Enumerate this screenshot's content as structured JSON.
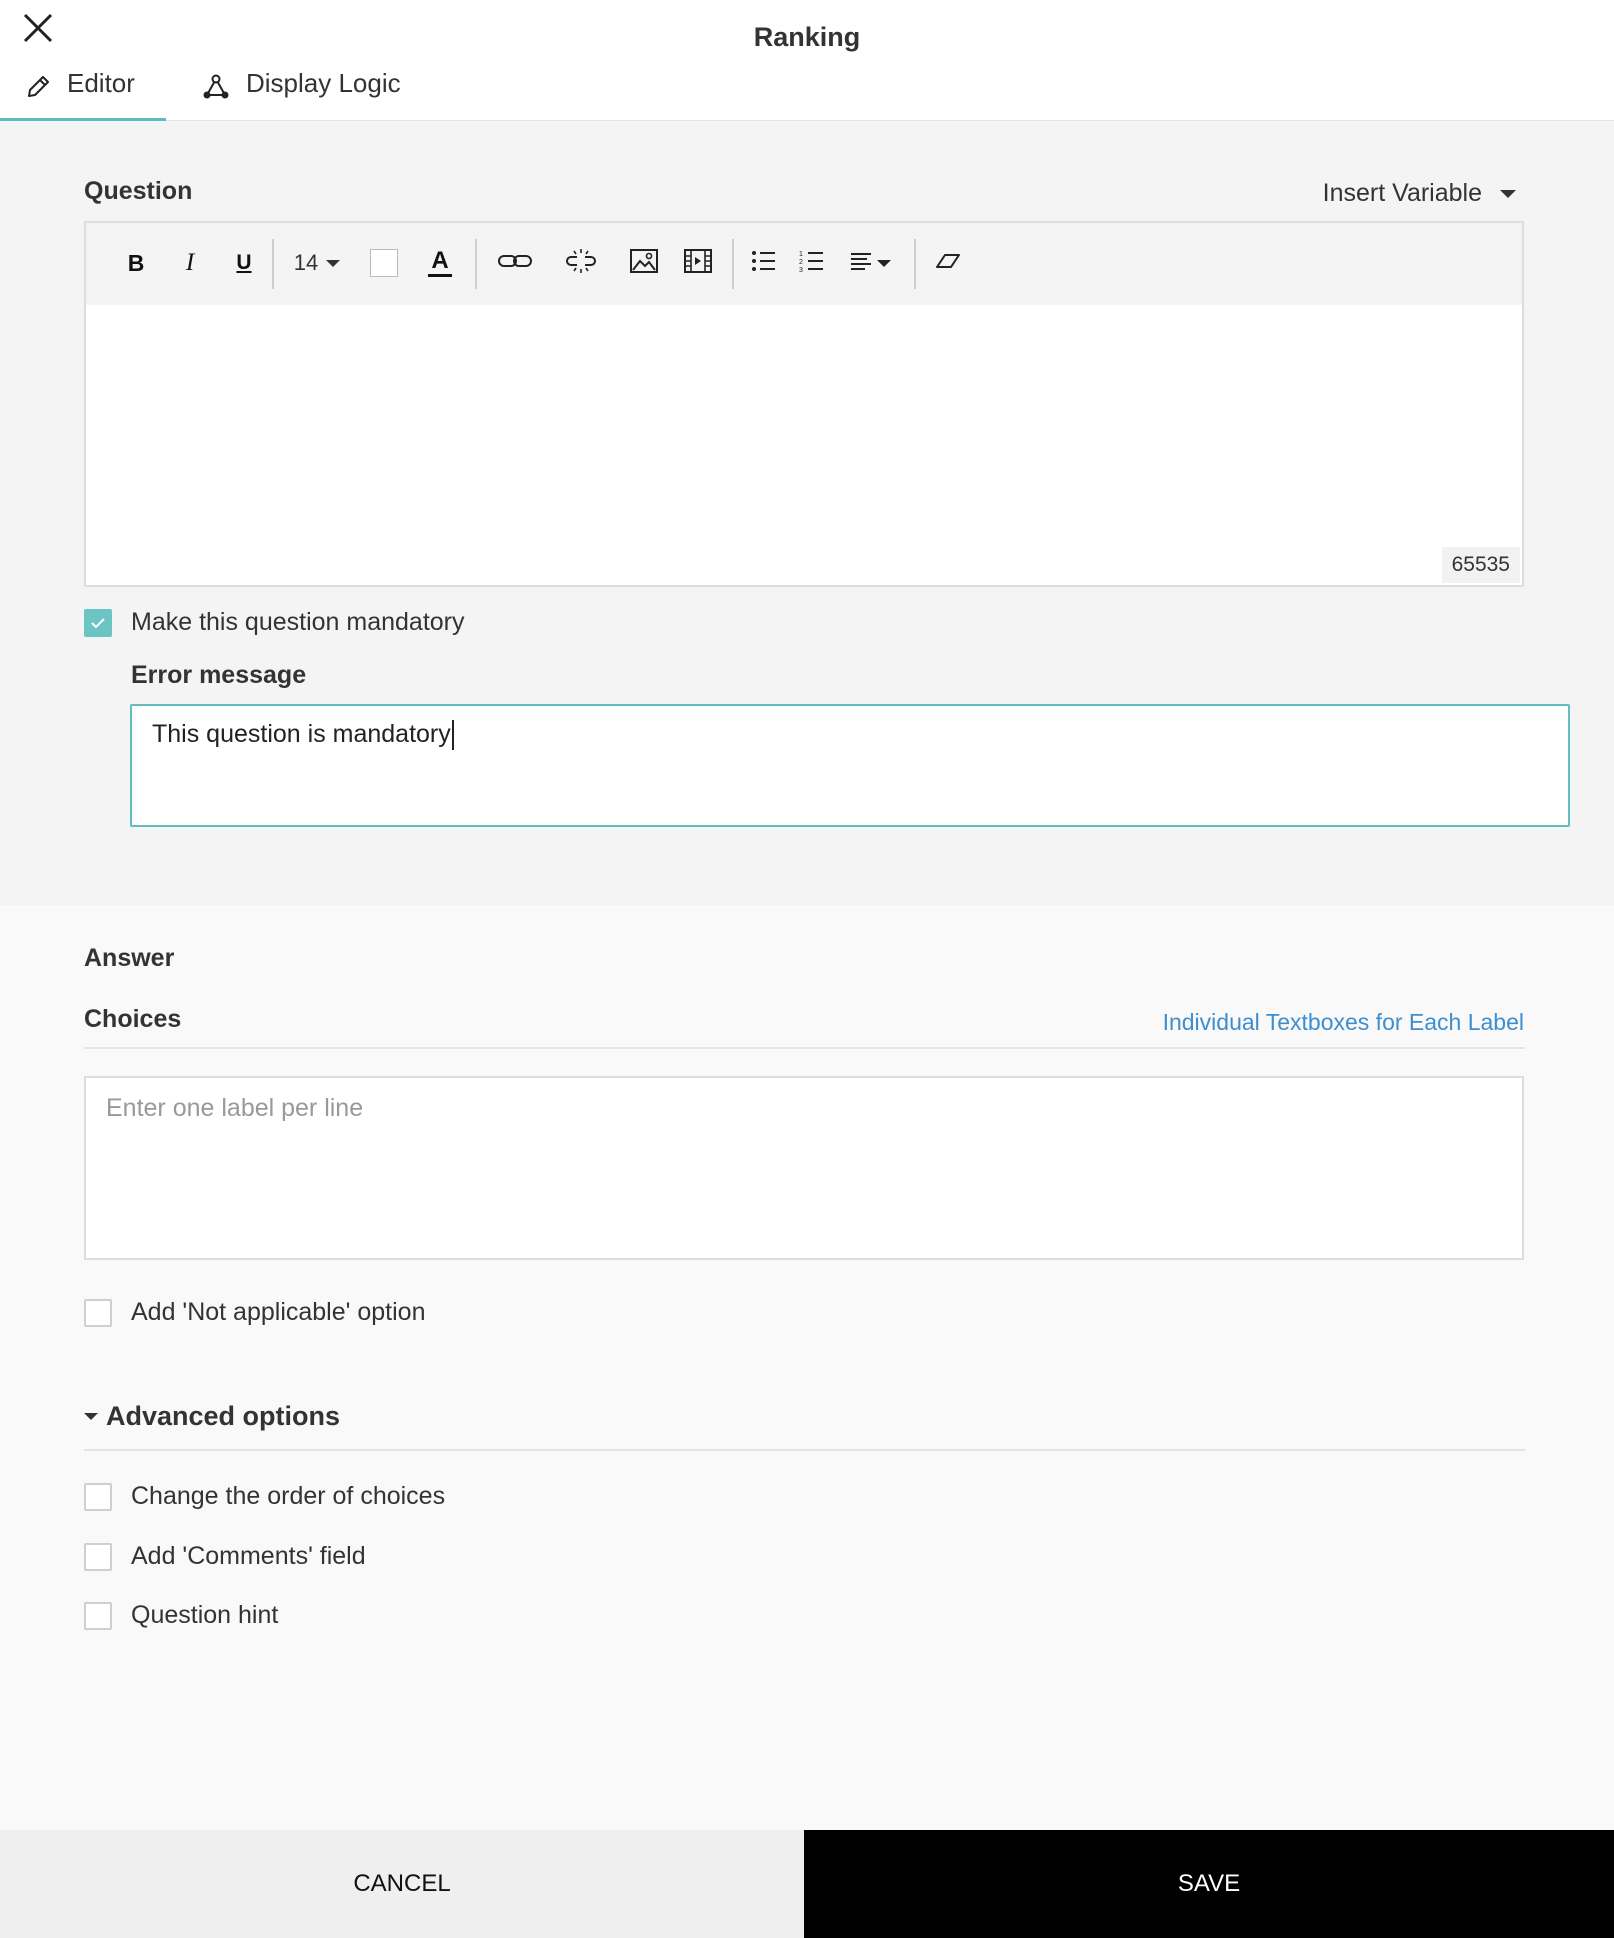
{
  "header": {
    "title": "Ranking",
    "close_icon": "close-icon",
    "tabs": [
      {
        "label": "Editor",
        "icon": "pencil-icon",
        "active": true
      },
      {
        "label": "Display Logic",
        "icon": "branch-logic-icon",
        "active": false
      }
    ]
  },
  "question": {
    "label": "Question",
    "insert_variable": "Insert Variable",
    "toolbar": {
      "bold": "B",
      "italic": "I",
      "underline": "U",
      "font_size": "14",
      "text_color_glyph": "A"
    },
    "char_count": "65535",
    "mandatory": {
      "label": "Make this question mandatory",
      "checked": true
    },
    "error_message": {
      "label": "Error message",
      "value": "This question is mandatory"
    }
  },
  "answer": {
    "label": "Answer",
    "choices_label": "Choices",
    "choices_link": "Individual Textboxes for Each Label",
    "choices_placeholder": "Enter one label per line",
    "not_applicable": {
      "label": "Add 'Not applicable' option",
      "checked": false
    },
    "advanced": {
      "label": "Advanced options",
      "options": [
        {
          "label": "Change the order of choices",
          "checked": false
        },
        {
          "label": "Add 'Comments' field",
          "checked": false
        },
        {
          "label": "Question hint",
          "checked": false
        }
      ]
    }
  },
  "footer": {
    "cancel": "CANCEL",
    "save": "SAVE"
  },
  "colors": {
    "accent": "#5bbcbd",
    "link": "#3d8ed1",
    "save_bg": "#000000"
  }
}
